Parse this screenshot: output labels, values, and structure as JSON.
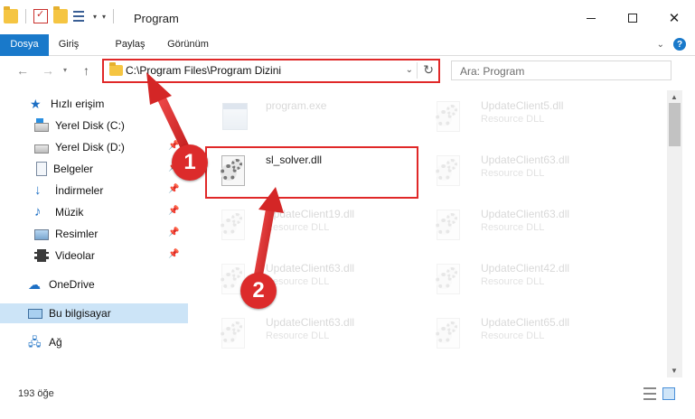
{
  "window": {
    "title": "Program"
  },
  "ribbon": {
    "tabs": [
      {
        "label": "Dosya"
      },
      {
        "label": "Giriş"
      },
      {
        "label": "Paylaş"
      },
      {
        "label": "Görünüm"
      }
    ],
    "help_label": "?"
  },
  "address": {
    "path": "C:\\Program Files\\Program Dizini"
  },
  "search": {
    "placeholder": "Ara: Program"
  },
  "sidebar": {
    "items": [
      {
        "label": "Hızlı erişim"
      },
      {
        "label": "Yerel Disk (C:)"
      },
      {
        "label": "Yerel Disk (D:)"
      },
      {
        "label": "Belgeler"
      },
      {
        "label": "İndirmeler"
      },
      {
        "label": "Müzik"
      },
      {
        "label": "Resimler"
      },
      {
        "label": "Videolar"
      },
      {
        "label": "OneDrive"
      },
      {
        "label": "Bu bilgisayar"
      },
      {
        "label": "Ağ"
      }
    ]
  },
  "files": [
    {
      "name": "program.exe",
      "desc": ""
    },
    {
      "name": "UpdateClient5.dll",
      "desc": "Resource DLL"
    },
    {
      "name": "sl_solver.dll",
      "desc": ""
    },
    {
      "name": "UpdateClient63.dll",
      "desc": "Resource DLL"
    },
    {
      "name": "UpdateClient19.dll",
      "desc": "Resource DLL"
    },
    {
      "name": "UpdateClient63.dll",
      "desc": "Resource DLL"
    },
    {
      "name": "UpdateClient63.dll",
      "desc": "Resource DLL"
    },
    {
      "name": "UpdateClient42.dll",
      "desc": "Resource DLL"
    },
    {
      "name": "UpdateClient63.dll",
      "desc": "Resource DLL"
    },
    {
      "name": "UpdateClient65.dll",
      "desc": "Resource DLL"
    }
  ],
  "status": {
    "count": "193 öğe"
  },
  "annotations": {
    "step1": "1",
    "step2": "2"
  },
  "colors": {
    "accent": "#1979ca",
    "highlight": "#e02828",
    "badge": "#dc2b2b"
  }
}
